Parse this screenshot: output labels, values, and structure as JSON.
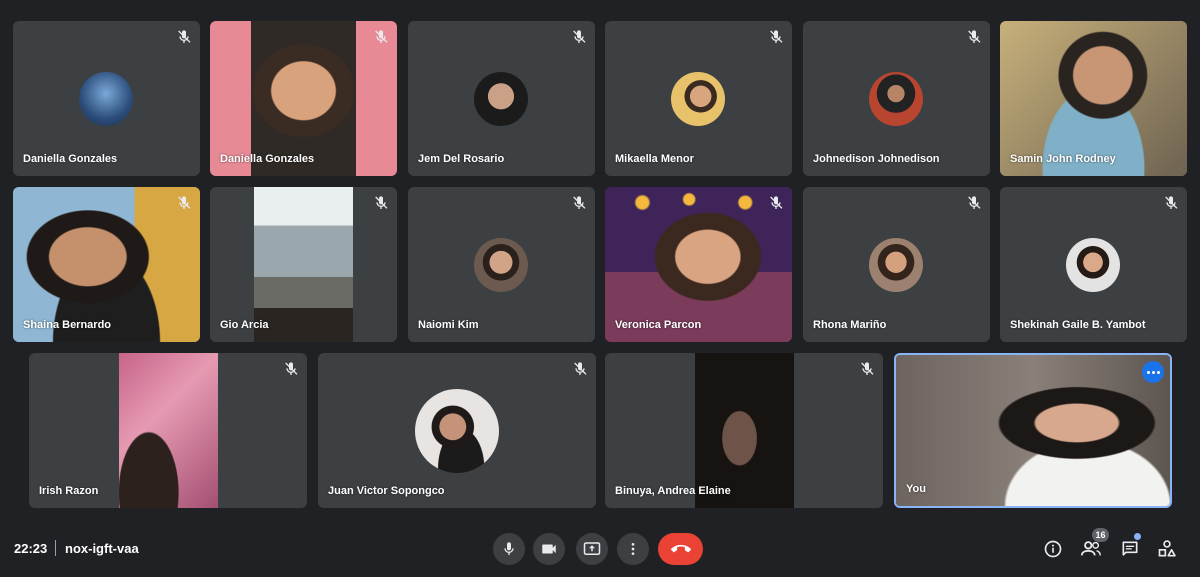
{
  "meeting": {
    "time": "22:23",
    "code": "nox-igft-vaa"
  },
  "participants": [
    {
      "name": "Daniella Gonzales",
      "mode": "avatar",
      "muted": true
    },
    {
      "name": "Daniella Gonzales",
      "mode": "video",
      "muted": true
    },
    {
      "name": "Jem Del Rosario",
      "mode": "avatar",
      "muted": true
    },
    {
      "name": "Mikaella Menor",
      "mode": "avatar",
      "muted": true
    },
    {
      "name": "Johnedison Johnedison",
      "mode": "avatar",
      "muted": true
    },
    {
      "name": "Samin John Rodney",
      "mode": "video",
      "muted": false
    },
    {
      "name": "Shaina Bernardo",
      "mode": "video",
      "muted": true
    },
    {
      "name": "Gio Arcia",
      "mode": "video",
      "muted": true
    },
    {
      "name": "Naiomi Kim",
      "mode": "avatar",
      "muted": true
    },
    {
      "name": "Veronica Parcon",
      "mode": "video",
      "muted": true
    },
    {
      "name": "Rhona Mariño",
      "mode": "avatar",
      "muted": true
    },
    {
      "name": "Shekinah Gaile B. Yambot",
      "mode": "avatar",
      "muted": true
    },
    {
      "name": "Irish Razon",
      "mode": "video",
      "muted": true
    },
    {
      "name": "Juan Victor Sopongco",
      "mode": "avatar",
      "muted": true
    },
    {
      "name": "Binuya, Andrea Elaine",
      "mode": "video",
      "muted": true
    },
    {
      "name": "You",
      "mode": "video",
      "muted": false,
      "self": true
    }
  ],
  "controls": {
    "left": [
      {
        "icon": "mic-icon"
      },
      {
        "icon": "camera-icon"
      },
      {
        "icon": "present-screen-icon"
      },
      {
        "icon": "more-options-icon"
      },
      {
        "icon": "end-call-icon"
      }
    ],
    "right": [
      {
        "icon": "info-icon"
      },
      {
        "icon": "people-icon",
        "badge": "16"
      },
      {
        "icon": "chat-icon"
      },
      {
        "icon": "activities-icon"
      }
    ]
  },
  "colors": {
    "background": "#202124",
    "tile": "#3c4043",
    "end_call": "#ea4335",
    "accent": "#8ab4f8"
  }
}
